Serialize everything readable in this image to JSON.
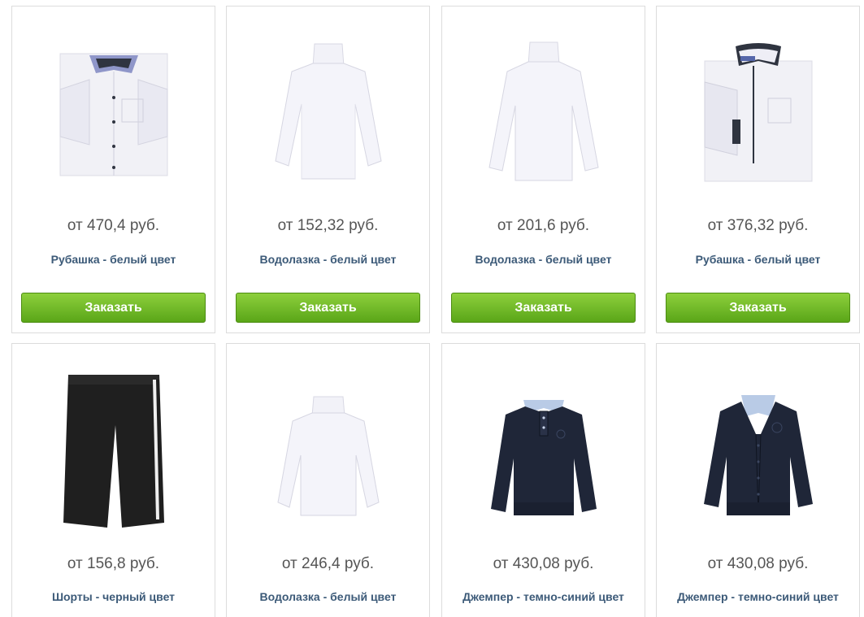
{
  "products": [
    {
      "price": "от 470,4 руб.",
      "name": "Рубашка - белый цвет",
      "image": "white-short-sleeve-shirt-image",
      "button": "Заказать"
    },
    {
      "price": "от 152,32 руб.",
      "name": "Водолазка - белый цвет",
      "image": "white-turtleneck-image",
      "button": "Заказать"
    },
    {
      "price": "от 201,6 руб.",
      "name": "Водолазка - белый цвет",
      "image": "white-turtleneck-image",
      "button": "Заказать"
    },
    {
      "price": "от 376,32 руб.",
      "name": "Рубашка - белый цвет",
      "image": "white-long-sleeve-shirt-image",
      "button": "Заказать"
    },
    {
      "price": "от 156,8 руб.",
      "name": "Шорты - черный цвет",
      "image": "black-shorts-image"
    },
    {
      "price": "от 246,4 руб.",
      "name": "Водолазка - белый цвет",
      "image": "white-turtleneck-image"
    },
    {
      "price": "от 430,08 руб.",
      "name": "Джемпер - темно-синий цвет",
      "image": "navy-jumper-image"
    },
    {
      "price": "от 430,08 руб.",
      "name": "Джемпер - темно-синий цвет",
      "image": "navy-cardigan-image"
    }
  ],
  "colors": {
    "button_top": "#8dcf3c",
    "button_bottom": "#5aa618",
    "title": "#3c5a78",
    "price": "#555555",
    "navy": "#1f2638"
  }
}
